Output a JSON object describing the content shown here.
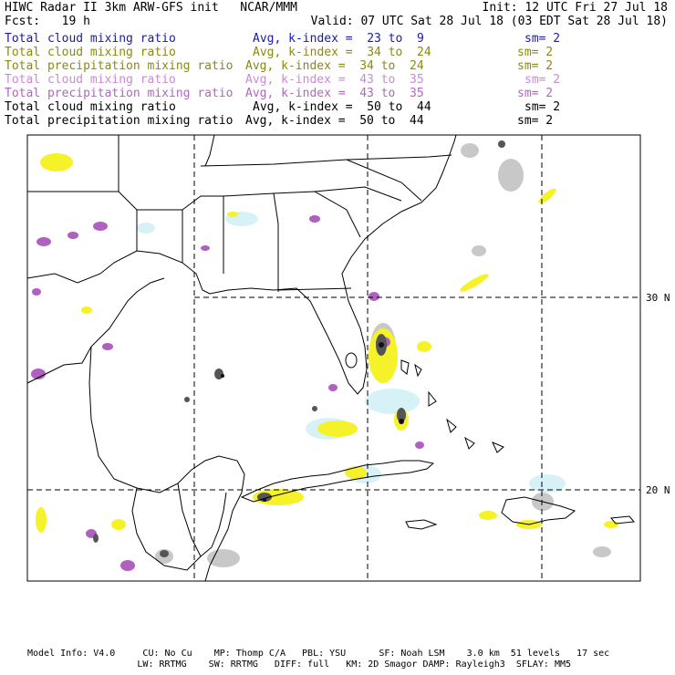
{
  "header": {
    "title": "HIWC Radar II 3km ARW-GFS init",
    "org": "NCAR/MMM",
    "init": "Init: 12 UTC Fri 27 Jul 18",
    "fcst_label": "Fcst:",
    "fcst_value": "19 h",
    "valid": "Valid: 07 UTC Sat 28 Jul 18 (03 EDT Sat 28 Jul 18)"
  },
  "fields": [
    {
      "name": "Total cloud mixing ratio",
      "avg": "Avg, k-index =  23 to  9",
      "sm": "sm= 2",
      "color": "#1a1aa8"
    },
    {
      "name": "Total cloud mixing ratio",
      "avg": "Avg, k-index =  34 to  24",
      "sm": "sm= 2",
      "color": "#8a8a10"
    },
    {
      "name": "Total precipitation mixing ratio",
      "avg": "Avg, k-index =  34 to  24",
      "sm": "sm= 2",
      "color": "#8a8a10"
    },
    {
      "name": "Total cloud mixing ratio",
      "avg": "Avg, k-index =  43 to  35",
      "sm": "sm= 2",
      "color": "#c98ad6"
    },
    {
      "name": "Total precipitation mixing ratio",
      "avg": "Avg, k-index =  43 to  35",
      "sm": "sm= 2",
      "color": "#b066c4"
    },
    {
      "name": "Total cloud mixing ratio",
      "avg": "Avg, k-index =  50 to  44",
      "sm": "sm= 2",
      "color": "#000000"
    },
    {
      "name": "Total precipitation mixing ratio",
      "avg": "Avg, k-index =  50 to  44",
      "sm": "sm= 2",
      "color": "#000000"
    }
  ],
  "map": {
    "lat_labels": [
      "30 N",
      "20 N"
    ],
    "colors": {
      "yellow": "#f5f22a",
      "purple": "#b060c0",
      "lightgray": "#c8c8c8",
      "darkgray": "#555555",
      "black": "#111111",
      "cyan": "#d7f2f7"
    }
  },
  "footer": {
    "line1": "Model Info: V4.0     CU: No Cu    MP: Thomp C/A   PBL: YSU      SF: Noah LSM    3.0 km  51 levels   17 sec",
    "line2": "                    LW: RRTMG    SW: RRTMG   DIFF: full   KM: 2D Smagor DAMP: Rayleigh3  SFLAY: MM5"
  }
}
